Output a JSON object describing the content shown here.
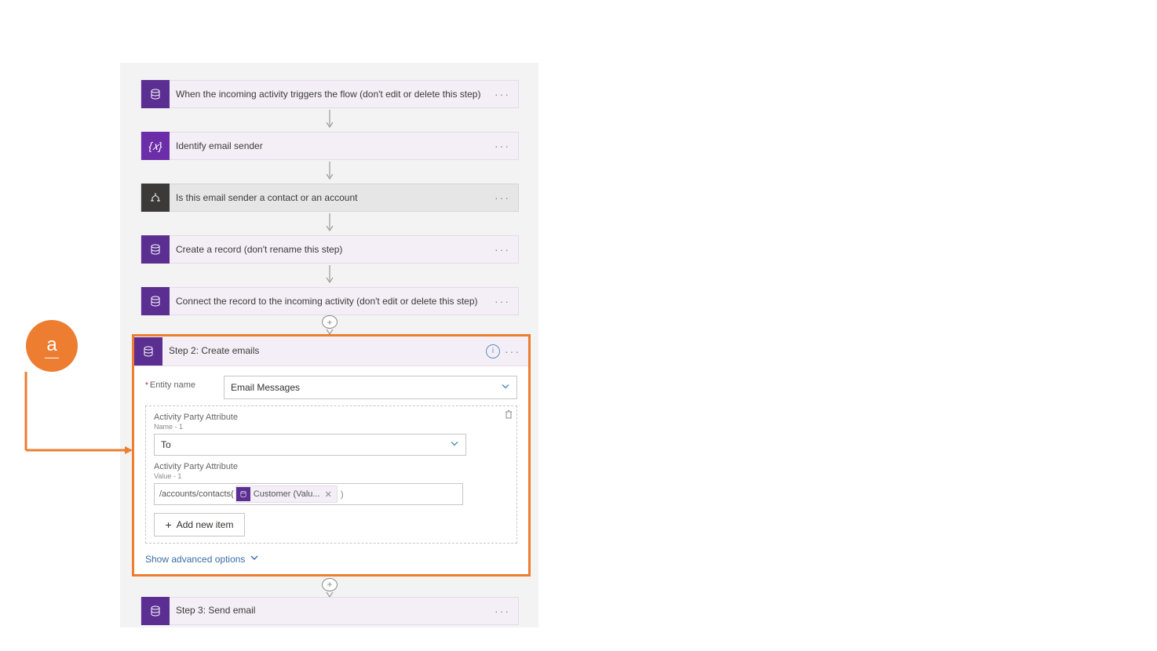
{
  "annotation": {
    "label": "a"
  },
  "steps": {
    "s1": "When the incoming activity triggers the flow (don't edit or delete this step)",
    "s2": "Identify email sender",
    "s3": "Is this email sender a contact or an account",
    "s4": "Create a record (don't rename this step)",
    "s5": "Connect the record to the incoming activity (don't edit or delete this step)",
    "s6": "Step 2: Create emails",
    "s7": "Step 3: Send email"
  },
  "emails_card": {
    "entity_label": "Entity name",
    "entity_value": "Email Messages",
    "attr1_label": "Activity Party Attribute",
    "attr1_sub": "Name - 1",
    "attr1_value": "To",
    "attr2_label": "Activity Party Attribute",
    "attr2_sub": "Value - 1",
    "attr2_prefix": "/accounts/contacts(",
    "attr2_token": "Customer (Valu...",
    "attr2_suffix": ")",
    "add_item": "Add new item",
    "show_adv": "Show advanced options"
  }
}
